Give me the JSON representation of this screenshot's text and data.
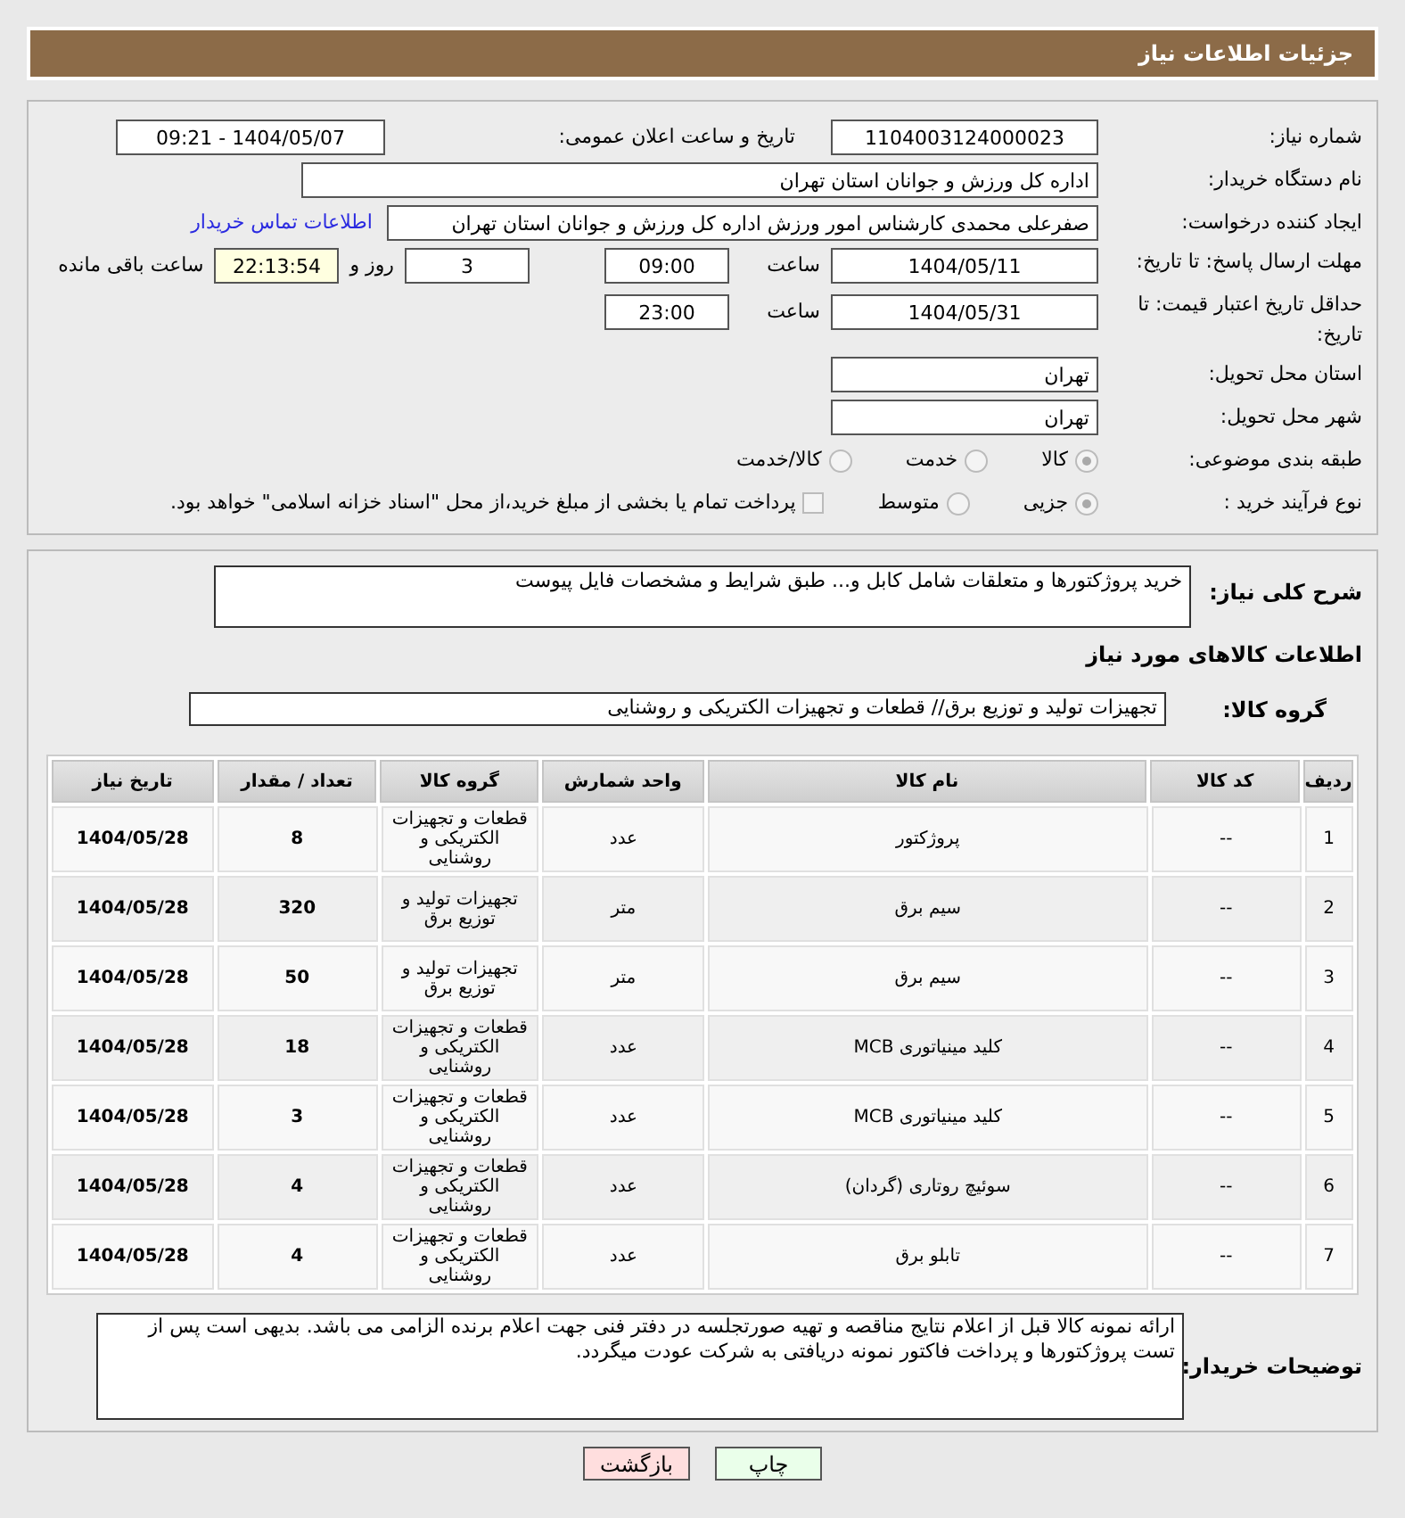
{
  "header": {
    "title": "جزئیات اطلاعات نیاز"
  },
  "need_number": {
    "label": "شماره نیاز:",
    "value": "1104003124000023"
  },
  "announce": {
    "label": "تاریخ و ساعت اعلان عمومی:",
    "value": "1404/05/07 - 09:21"
  },
  "buyer": {
    "label": "نام دستگاه خریدار:",
    "value": "اداره کل ورزش و جوانان استان تهران"
  },
  "requester": {
    "label": "ایجاد کننده درخواست:",
    "value": "صفرعلی محمدی کارشناس امور ورزش اداره کل ورزش و جوانان استان تهران",
    "link": "اطلاعات تماس خریدار"
  },
  "deadline": {
    "label": "مهلت ارسال پاسخ: تا تاریخ:",
    "date": "1404/05/11",
    "time_label": "ساعت",
    "time": "09:00",
    "days": "3",
    "days_label": "روز و",
    "remaining": "22:13:54",
    "remaining_label": "ساعت باقی مانده"
  },
  "validity": {
    "label": "حداقل تاریخ اعتبار قیمت: تا تاریخ:",
    "date": "1404/05/31",
    "time_label": "ساعت",
    "time": "23:00"
  },
  "province": {
    "label": "استان محل تحویل:",
    "value": "تهران"
  },
  "city": {
    "label": "شهر محل تحویل:",
    "value": "تهران"
  },
  "category": {
    "label": "طبقه بندی موضوعی:",
    "options": [
      {
        "label": "کالا",
        "selected": true
      },
      {
        "label": "خدمت",
        "selected": false
      },
      {
        "label": "کالا/خدمت",
        "selected": false
      }
    ]
  },
  "process": {
    "label": "نوع فرآیند خرید :",
    "options": [
      {
        "label": "جزیی",
        "selected": true
      },
      {
        "label": "متوسط",
        "selected": false
      }
    ],
    "payment": {
      "label": "پرداخت تمام یا بخشی از مبلغ خرید،از محل \"اسناد خزانه اسلامی\" خواهد بود.",
      "checked": false
    }
  },
  "description": {
    "label": "شرح کلی نیاز:",
    "value": "خرید پروژکتورها و متعلقات شامل کابل و... طبق شرایط و مشخصات فایل پیوست"
  },
  "goods_title": "اطلاعات کالاهای مورد نیاز",
  "goods_group": {
    "label": "گروه کالا:",
    "value": "تجهیزات تولید و توزیع برق// قطعات و تجهیزات الکتریکی و روشنایی"
  },
  "table": {
    "columns": [
      "ردیف",
      "کد کالا",
      "نام کالا",
      "واحد شمارش",
      "گروه کالا",
      "تعداد / مقدار",
      "تاریخ نیاز"
    ],
    "rows": [
      [
        "1",
        "--",
        "پروژکتور",
        "عدد",
        "قطعات و تجهیزات الکتریکی و روشنایی",
        "8",
        "1404/05/28"
      ],
      [
        "2",
        "--",
        "سیم برق",
        "متر",
        "تجهیزات تولید و توزیع برق",
        "320",
        "1404/05/28"
      ],
      [
        "3",
        "--",
        "سیم برق",
        "متر",
        "تجهیزات تولید و توزیع برق",
        "50",
        "1404/05/28"
      ],
      [
        "4",
        "--",
        "کلید مینیاتوری MCB",
        "عدد",
        "قطعات و تجهیزات الکتریکی و روشنایی",
        "18",
        "1404/05/28"
      ],
      [
        "5",
        "--",
        "کلید مینیاتوری MCB",
        "عدد",
        "قطعات و تجهیزات الکتریکی و روشنایی",
        "3",
        "1404/05/28"
      ],
      [
        "6",
        "--",
        "سوئیچ روتاری (گردان)",
        "عدد",
        "قطعات و تجهیزات الکتریکی و روشنایی",
        "4",
        "1404/05/28"
      ],
      [
        "7",
        "--",
        "تابلو برق",
        "عدد",
        "قطعات و تجهیزات الکتریکی و روشنایی",
        "4",
        "1404/05/28"
      ]
    ]
  },
  "buyer_notes": {
    "label": "توضیحات خریدار:",
    "value": "ارائه نمونه کالا قبل از اعلام نتایج مناقصه و تهیه صورتجلسه در دفتر فنی جهت اعلام برنده الزامی می باشد. بدیهی است پس از تست پروژکتورها و پرداخت فاکتور نمونه دریافتی به شرکت عودت میگردد."
  },
  "buttons": [
    {
      "label": "چاپ",
      "kind": "print"
    },
    {
      "label": "بازگشت",
      "kind": "back"
    }
  ]
}
